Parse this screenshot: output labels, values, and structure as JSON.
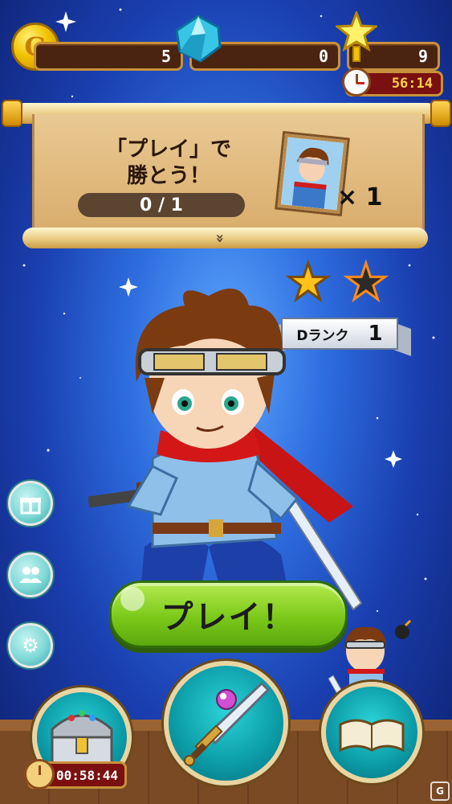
{
  "hud": {
    "gold_icon": "G",
    "gold_count": "5",
    "gem_count": "0",
    "star_count": "9",
    "event_timer": "56:14"
  },
  "quest": {
    "title_line1": "「プレイ」で",
    "title_line2": "勝とう！",
    "progress": "0 / 1",
    "reward_multiplier": "× 1",
    "expand_icon": "»"
  },
  "rank": {
    "stars_earned": 1,
    "stars_total": 2,
    "label": "Dランク",
    "level": "1"
  },
  "side_buttons": [
    "gift-icon",
    "friends-icon",
    "settings-icon"
  ],
  "play_label": "プレイ！",
  "chest_timer": "00:58:44",
  "colors": {
    "play_green": "#7cc91a",
    "timer_red": "#7a1010",
    "gold": "#f2c200"
  }
}
